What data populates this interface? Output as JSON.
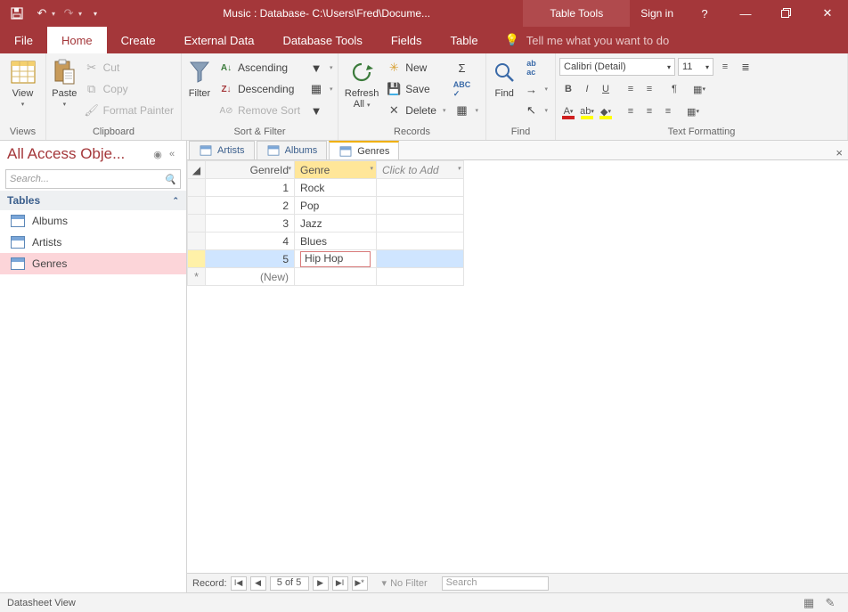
{
  "titlebar": {
    "title": "Music : Database- C:\\Users\\Fred\\Docume...",
    "context": "Table Tools",
    "signin": "Sign in"
  },
  "tabs": {
    "file": "File",
    "home": "Home",
    "create": "Create",
    "external": "External Data",
    "dbtools": "Database Tools",
    "fields": "Fields",
    "table": "Table",
    "tellme": "Tell me what you want to do"
  },
  "ribbon": {
    "views": {
      "view": "View",
      "group": "Views"
    },
    "clipboard": {
      "paste": "Paste",
      "cut": "Cut",
      "copy": "Copy",
      "painter": "Format Painter",
      "group": "Clipboard"
    },
    "sortfilter": {
      "filter": "Filter",
      "asc": "Ascending",
      "desc": "Descending",
      "remove": "Remove Sort",
      "group": "Sort & Filter"
    },
    "records": {
      "refresh_top": "Refresh",
      "refresh_bot": "All",
      "new": "New",
      "save": "Save",
      "delete": "Delete",
      "group": "Records"
    },
    "find": {
      "find": "Find",
      "group": "Find"
    },
    "text": {
      "font": "Calibri (Detail)",
      "size": "11",
      "group": "Text Formatting"
    }
  },
  "nav": {
    "header": "All Access Obje...",
    "search": "Search...",
    "tables": "Tables",
    "items": [
      "Albums",
      "Artists",
      "Genres"
    ]
  },
  "doctabs": [
    "Artists",
    "Albums",
    "Genres"
  ],
  "datasheet": {
    "cols": {
      "id": "GenreId",
      "genre": "Genre",
      "add": "Click to Add"
    },
    "rows": [
      {
        "id": "1",
        "genre": "Rock"
      },
      {
        "id": "2",
        "genre": "Pop"
      },
      {
        "id": "3",
        "genre": "Jazz"
      },
      {
        "id": "4",
        "genre": "Blues"
      },
      {
        "id": "5",
        "genre": "Hip Hop"
      }
    ],
    "new": "(New)"
  },
  "recnav": {
    "label": "Record:",
    "pos": "5 of 5",
    "nofilter": "No Filter",
    "search": "Search"
  },
  "status": {
    "view": "Datasheet View"
  }
}
